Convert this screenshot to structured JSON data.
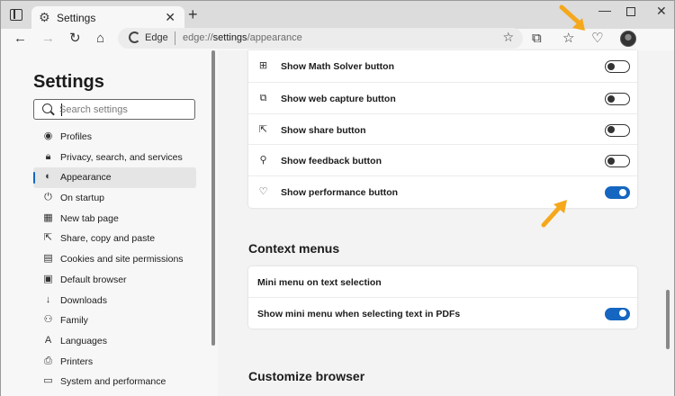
{
  "window": {
    "tab_title": "Settings",
    "new_tab_symbol": "+",
    "minimize_symbol": "—",
    "close_symbol": "✕"
  },
  "toolbar": {
    "edge_label": "Edge",
    "url_prefix": "edge://",
    "url_host": "settings",
    "url_path": "/appearance"
  },
  "sidebar": {
    "title": "Settings",
    "search_placeholder": "Search settings",
    "items": [
      {
        "label": "Profiles",
        "icon": "profile-icon"
      },
      {
        "label": "Privacy, search, and services",
        "icon": "lock-icon"
      },
      {
        "label": "Appearance",
        "icon": "palette-icon",
        "active": true
      },
      {
        "label": "On startup",
        "icon": "power-icon"
      },
      {
        "label": "New tab page",
        "icon": "new-tab-page-icon"
      },
      {
        "label": "Share, copy and paste",
        "icon": "share-icon"
      },
      {
        "label": "Cookies and site permissions",
        "icon": "site-permissions-icon"
      },
      {
        "label": "Default browser",
        "icon": "browser-icon"
      },
      {
        "label": "Downloads",
        "icon": "download-icon"
      },
      {
        "label": "Family",
        "icon": "family-icon"
      },
      {
        "label": "Languages",
        "icon": "languages-icon"
      },
      {
        "label": "Printers",
        "icon": "printer-icon"
      },
      {
        "label": "System and performance",
        "icon": "system-icon"
      }
    ]
  },
  "toolbar_buttons_card": {
    "rows": [
      {
        "label": "Show Math Solver button",
        "icon": "math-solver-icon",
        "on": false
      },
      {
        "label": "Show web capture button",
        "icon": "web-capture-icon",
        "on": false
      },
      {
        "label": "Show share button",
        "icon": "share-icon",
        "on": false
      },
      {
        "label": "Show feedback button",
        "icon": "feedback-icon",
        "on": false
      },
      {
        "label": "Show performance button",
        "icon": "performance-icon",
        "on": true
      }
    ]
  },
  "context_menus": {
    "title": "Context menus",
    "rows": [
      {
        "label": "Mini menu on text selection"
      },
      {
        "label": "Show mini menu when selecting text in PDFs",
        "on": true
      }
    ]
  },
  "customize": {
    "title": "Customize browser"
  },
  "colors": {
    "accent": "#1566c0",
    "arrow": "#f5a81c"
  }
}
